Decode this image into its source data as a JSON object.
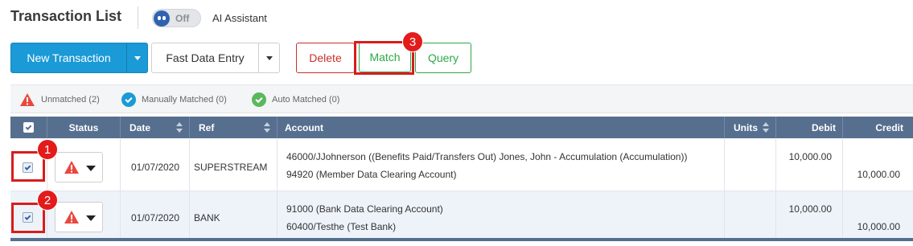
{
  "page": {
    "title": "Transaction List"
  },
  "ai_toggle": {
    "state": "Off",
    "label": "AI Assistant"
  },
  "toolbar": {
    "new_transaction": "New Transaction",
    "fast_data_entry": "Fast Data Entry",
    "delete": "Delete",
    "match": "Match",
    "query": "Query"
  },
  "legend": {
    "unmatched": "Unmatched (2)",
    "manually_matched": "Manually Matched (0)",
    "auto_matched": "Auto Matched (0)"
  },
  "table": {
    "headers": {
      "status": "Status",
      "date": "Date",
      "ref": "Ref",
      "account": "Account",
      "units": "Units",
      "debit": "Debit",
      "credit": "Credit"
    },
    "rows": [
      {
        "date": "01/07/2020",
        "ref": "SUPERSTREAM",
        "account_line1": "46000/JJohnerson ((Benefits Paid/Transfers Out) Jones, John - Accumulation (Accumulation))",
        "account_line2": "94920 (Member Data Clearing Account)",
        "units": "",
        "debit": "10,000.00",
        "credit": "10,000.00"
      },
      {
        "date": "01/07/2020",
        "ref": "BANK",
        "account_line1": "91000 (Bank Data Clearing Account)",
        "account_line2": "60400/Testhe (Test Bank)",
        "units": "",
        "debit": "10,000.00",
        "credit": "10,000.00"
      }
    ]
  },
  "annotations": {
    "badge1": "1",
    "badge2": "2",
    "badge3": "3"
  },
  "colors": {
    "primary": "#1a9ad6",
    "danger": "#c9302c",
    "success": "#2ea84a",
    "header": "#566f8f",
    "highlight": "#d91c1c"
  },
  "icons": {
    "toggle_knob": "robot-icon",
    "unmatched": "warning-triangle-icon",
    "manually_matched": "check-circle-blue-icon",
    "auto_matched": "check-circle-green-icon"
  }
}
